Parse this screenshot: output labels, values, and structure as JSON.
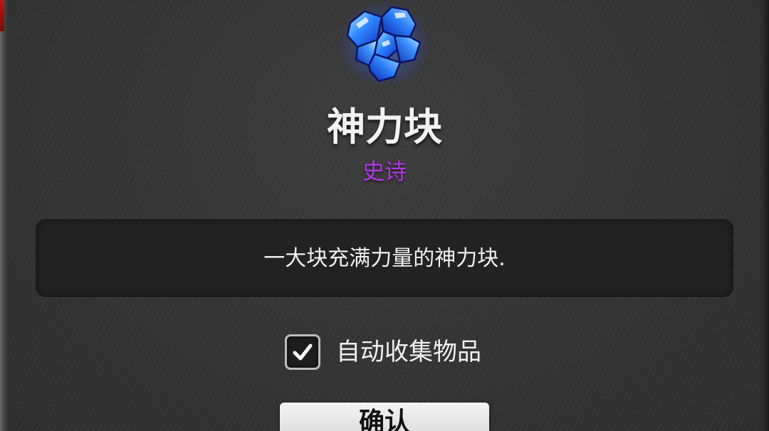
{
  "item": {
    "icon": "blue-crystal-gem-icon",
    "name": "神力块",
    "rarity": "史诗",
    "rarity_color": "#b335e8",
    "description": "一大块充满力量的神力块."
  },
  "auto_collect": {
    "label": "自动收集物品",
    "checked": true,
    "icon": "checkmark-icon"
  },
  "buttons": {
    "confirm_label": "确认"
  },
  "colors": {
    "background": "#353535",
    "panel": "#222222",
    "text": "#f2f2f2",
    "button": "#e6e6e6"
  }
}
